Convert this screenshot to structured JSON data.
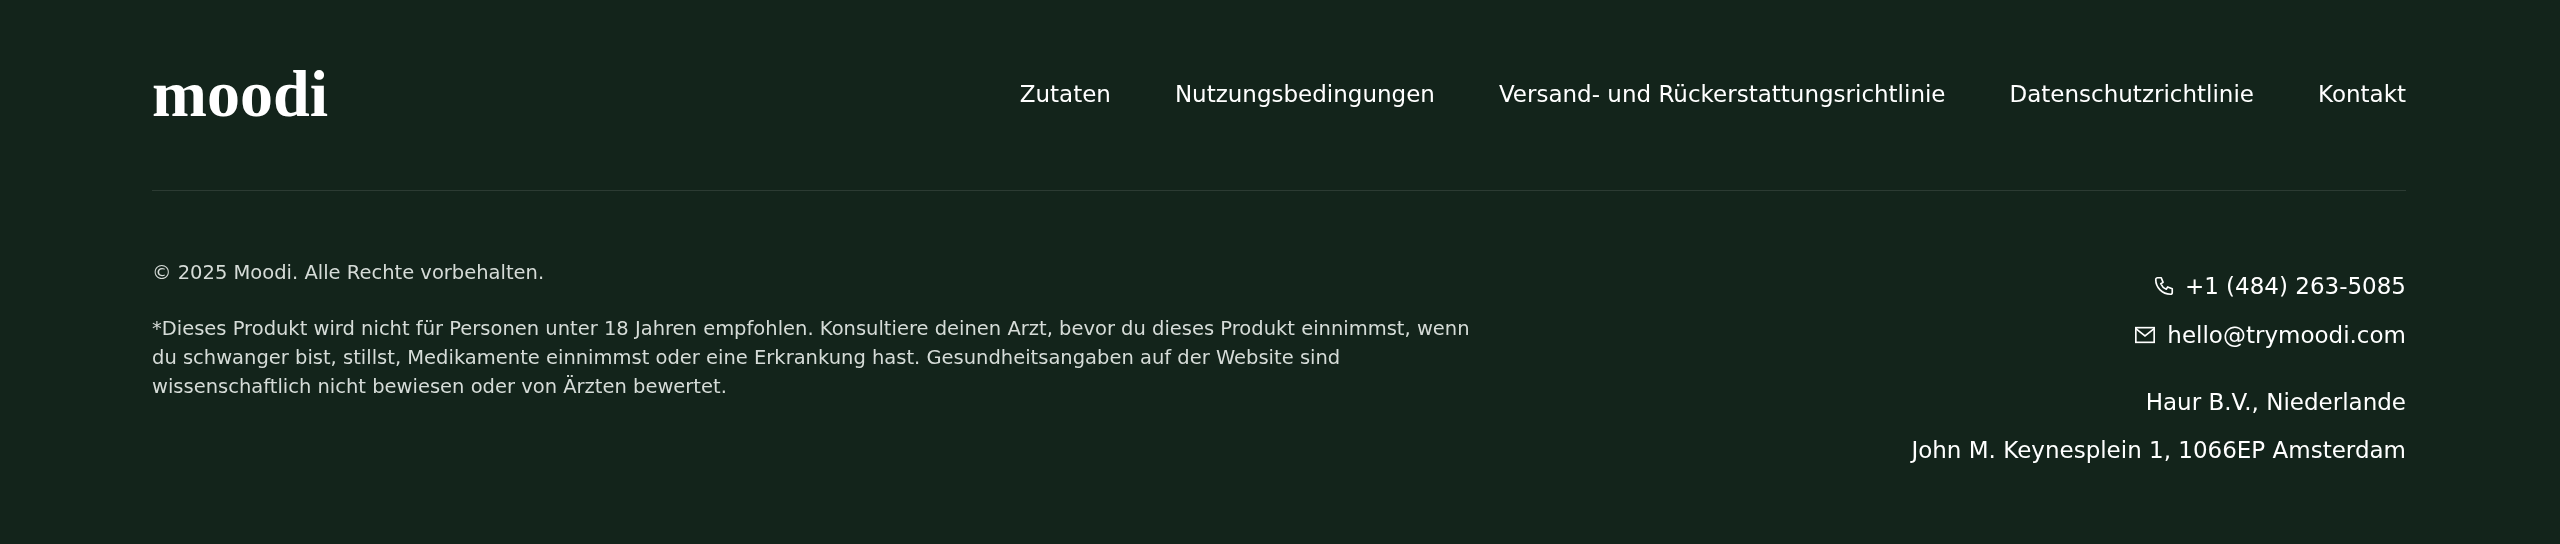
{
  "logo": "moodi",
  "nav": [
    {
      "label": "Zutaten"
    },
    {
      "label": "Nutzungsbedingungen"
    },
    {
      "label": "Versand- und Rückerstattungsrichtlinie"
    },
    {
      "label": "Datenschutzrichtlinie"
    },
    {
      "label": "Kontakt"
    }
  ],
  "copyright": "© 2025 Moodi. Alle Rechte vorbehalten.",
  "disclaimer": "*Dieses Produkt wird nicht für Personen unter 18 Jahren empfohlen. Konsultiere deinen Arzt, bevor du dieses Produkt einnimmst, wenn du schwanger bist, stillst, Medikamente einnimmst oder eine Erkrankung hast. Gesundheitsangaben auf der Website sind wissenschaftlich nicht bewiesen oder von Ärzten bewertet.",
  "contacts": [
    {
      "kind": "phone",
      "text": "+1 (484) 263-5085"
    },
    {
      "kind": "email",
      "text": "hello@trymoodi.com"
    }
  ],
  "address": [
    "Haur B.V., Niederlande",
    "John M. Keynesplein 1, 1066EP Amsterdam"
  ]
}
